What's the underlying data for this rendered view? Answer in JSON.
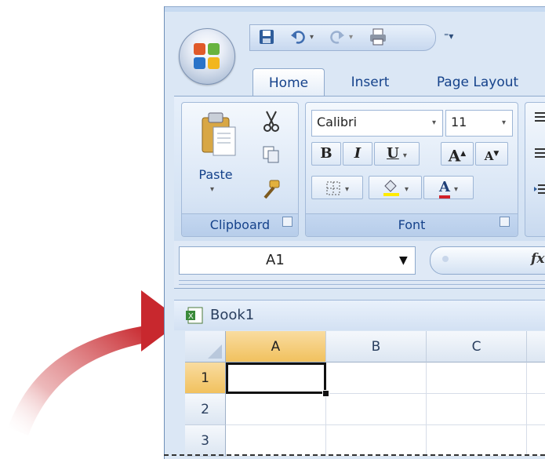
{
  "ribbon": {
    "tabs": [
      {
        "label": "Home",
        "active": true
      },
      {
        "label": "Insert",
        "active": false
      },
      {
        "label": "Page Layout",
        "active": false
      }
    ],
    "clipboard": {
      "paste_label": "Paste",
      "group_label": "Clipboard"
    },
    "font": {
      "group_label": "Font",
      "font_name": "Calibri",
      "font_size": "11",
      "bold": "B",
      "italic": "I",
      "underline": "U",
      "grow_font": "A",
      "shrink_font": "A",
      "font_color": "A"
    }
  },
  "formula_bar": {
    "name_box": "A1",
    "fx_label": "fx"
  },
  "workbook": {
    "title": "Book1",
    "columns": [
      "A",
      "B",
      "C"
    ],
    "rows": [
      "1",
      "2",
      "3"
    ],
    "active_cell": "A1"
  },
  "colors": {
    "accent_arrow": "#c8282e",
    "selected_header": "#f4c76a",
    "ribbon_text": "#15428b"
  }
}
